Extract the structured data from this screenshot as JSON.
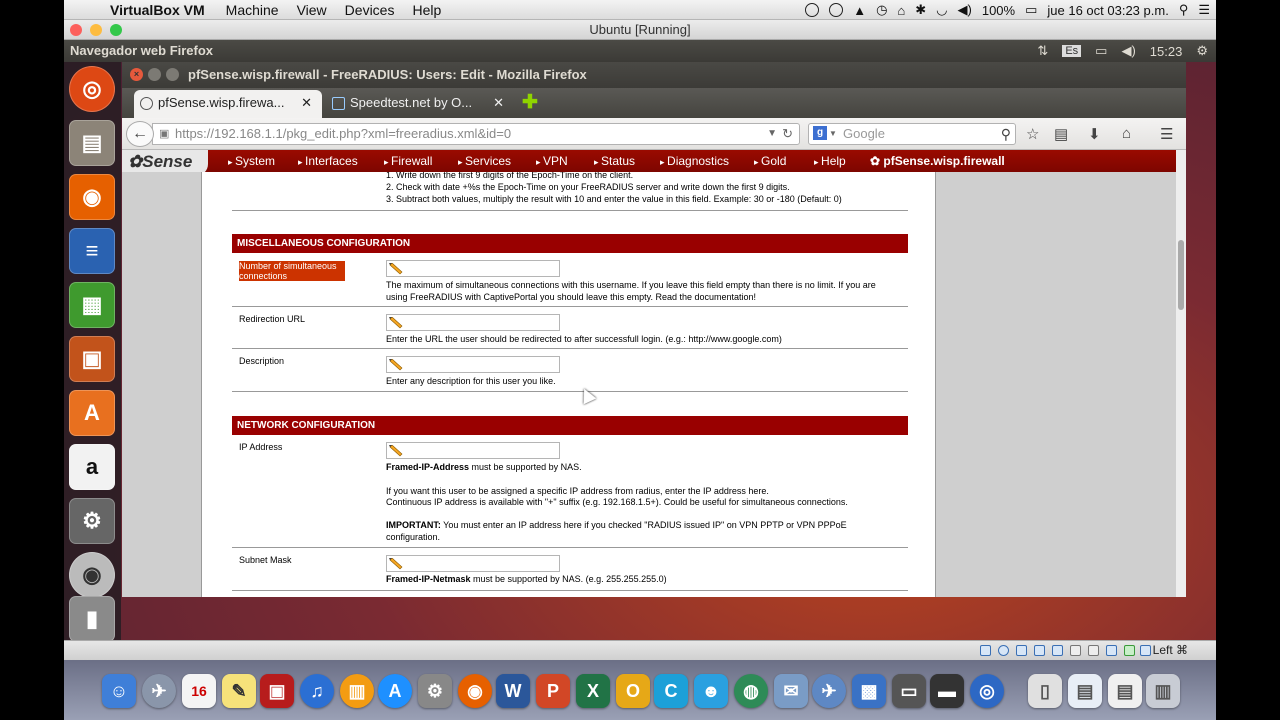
{
  "mac_menubar": {
    "app_name": "VirtualBox VM",
    "menus": [
      "Machine",
      "View",
      "Devices",
      "Help"
    ],
    "battery": "100%",
    "clock": "jue 16 oct  03:23 p.m."
  },
  "vbox_window": {
    "title": "Ubuntu [Running]"
  },
  "ubuntu_panel": {
    "title": "Navegador web Firefox",
    "keyboard": "Es",
    "clock": "15:23"
  },
  "firefox": {
    "window_title": "pfSense.wisp.firewall - FreeRADIUS: Users: Edit - Mozilla Firefox",
    "tabs": [
      {
        "label": "pfSense.wisp.firewa...",
        "active": true
      },
      {
        "label": "Speedtest.net by O...",
        "active": false
      }
    ],
    "url_host": "https://192.168.1.1",
    "url_path": "/pkg_edit.php?xml=freeradius.xml&id=0",
    "search_placeholder": "Google"
  },
  "pfsense": {
    "logo": "Sense",
    "menu": [
      "System",
      "Interfaces",
      "Firewall",
      "Services",
      "VPN",
      "Status",
      "Diagnostics",
      "Gold",
      "Help"
    ],
    "hostname": "pfSense.wisp.firewall",
    "top_help": [
      "1. Write down the first 9 digits of the Epoch-Time on the client.",
      "2. Check with date +%s the Epoch-Time on your FreeRADIUS server and write down the first 9 digits.",
      "3. Subtract both values, multiply the result with 10 and enter the value in this field. Example: 30 or -180 (Default: 0)"
    ],
    "misc_section": {
      "title": "MISCELLANEOUS CONFIGURATION",
      "fields": [
        {
          "label": "Number of simultaneous connections",
          "description": "The maximum of simultaneous connections with this username. If you leave this field empty than there is no limit. If you are using FreeRADIUS with CaptivePortal you should leave this empty. Read the documentation!"
        },
        {
          "label": "Redirection URL",
          "description": "Enter the URL the user should be redirected to after successfull login. (e.g.: http://www.google.com)"
        },
        {
          "label": "Description",
          "description": "Enter any description for this user you like."
        }
      ]
    },
    "network_section": {
      "title": "NETWORK CONFIGURATION",
      "ip_label": "IP Address",
      "ip_desc_bold": "Framed-IP-Address",
      "ip_desc_rest": " must be supported by NAS.",
      "ip_desc_2": "If you want this user to be assigned a specific IP address from radius, enter the IP address here.",
      "ip_desc_3": "Continuous IP address is available with \"+\" suffix (e.g. 192.168.1.5+). Could be useful for simultaneous connections.",
      "ip_important_bold": "IMPORTANT:",
      "ip_important_rest": " You must enter an IP address here if you checked \"RADIUS issued IP\" on VPN PPTP or VPN PPPoE configuration.",
      "subnet_label": "Subnet Mask",
      "subnet_desc_bold": "Framed-IP-Netmask",
      "subnet_desc_rest": " must be supported by NAS. (e.g. 255.255.255.0)"
    }
  },
  "vbox_status": {
    "host_key": "Left ⌘"
  }
}
